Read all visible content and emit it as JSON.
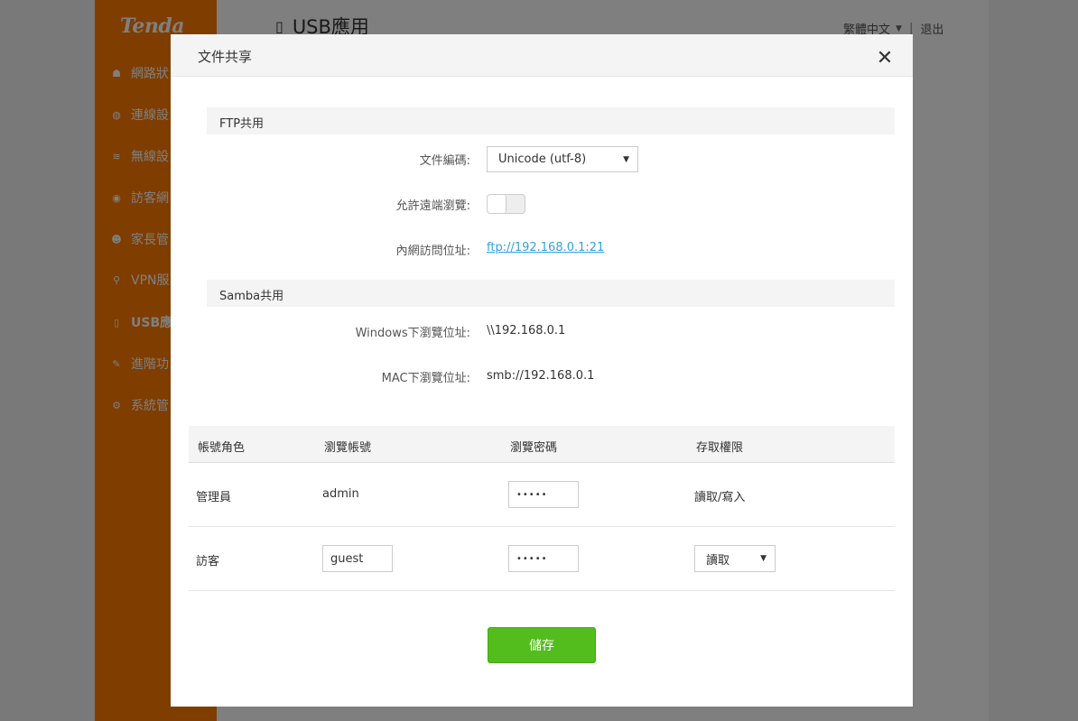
{
  "brand": {
    "logo": "Tenda",
    "accent": "#ff7b00"
  },
  "sidebar": {
    "items": [
      {
        "label": "網路狀",
        "icon": "network-status-icon",
        "glyph": "☗"
      },
      {
        "label": "連線設",
        "icon": "globe-icon",
        "glyph": "◍"
      },
      {
        "label": "無線設",
        "icon": "wifi-icon",
        "glyph": "≋"
      },
      {
        "label": "訪客網",
        "icon": "guest-network-icon",
        "glyph": "◉"
      },
      {
        "label": "家長管",
        "icon": "parental-control-icon",
        "glyph": "☻"
      },
      {
        "label": "VPN服",
        "icon": "vpn-icon",
        "glyph": "⚲"
      },
      {
        "label": "USB應",
        "icon": "usb-icon",
        "glyph": "▯",
        "active": true
      },
      {
        "label": "進階功",
        "icon": "wrench-icon",
        "glyph": "✎"
      },
      {
        "label": "系統管",
        "icon": "system-settings-icon",
        "glyph": "⚙"
      }
    ]
  },
  "header": {
    "page_title": "USB應用",
    "language": "繁體中文",
    "logout": "退出"
  },
  "modal": {
    "title": "文件共享",
    "close_glyph": "✕",
    "ftp": {
      "section_title": "FTP共用",
      "encoding_label": "文件編碼:",
      "encoding_value": "Unicode (utf-8)",
      "remote_browse_label": "允許遠端瀏覽:",
      "remote_browse_enabled": false,
      "lan_address_label": "內網訪問位址:",
      "lan_address_value": "ftp://192.168.0.1:21"
    },
    "samba": {
      "section_title": "Samba共用",
      "windows_label": "Windows下瀏覽位址:",
      "windows_value": "\\\\192.168.0.1",
      "mac_label": "MAC下瀏覽位址:",
      "mac_value": "smb://192.168.0.1"
    },
    "accounts": {
      "columns": [
        "帳號角色",
        "瀏覽帳號",
        "瀏覽密碼",
        "存取權限"
      ],
      "rows": [
        {
          "role": "管理員",
          "account": "admin",
          "password": "•••••",
          "permission": "讀取/寫入"
        },
        {
          "role": "訪客",
          "account": "guest",
          "password": "•••••",
          "permission": "讀取"
        }
      ]
    },
    "save_label": "儲存",
    "save_color": "#52bd1d"
  }
}
